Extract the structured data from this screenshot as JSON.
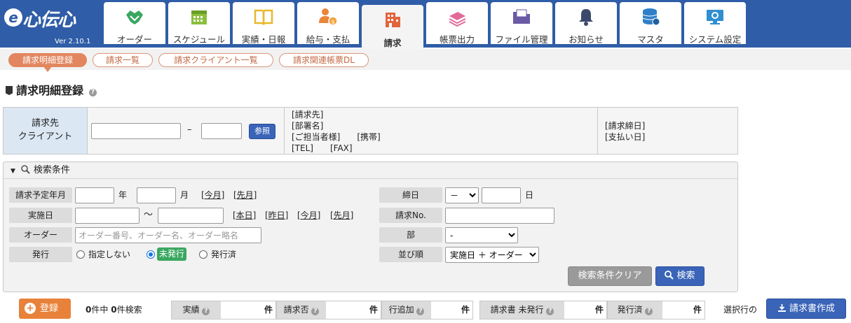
{
  "app": {
    "name": "心伝心",
    "mark": "e",
    "version": "Ver 2.10.1"
  },
  "nav": [
    {
      "label": "オーダー",
      "icon": "handshake-icon"
    },
    {
      "label": "スケジュール",
      "icon": "calendar-icon"
    },
    {
      "label": "実績・日報",
      "icon": "open-book-icon"
    },
    {
      "label": "給与・支払",
      "icon": "person-coin-icon"
    },
    {
      "label": "請求",
      "icon": "building-icon"
    },
    {
      "label": "帳票出力",
      "icon": "papers-icon"
    },
    {
      "label": "ファイル管理",
      "icon": "folder-icon"
    },
    {
      "label": "お知らせ",
      "icon": "bell-icon"
    },
    {
      "label": "マスタ",
      "icon": "database-icon"
    },
    {
      "label": "システム設定",
      "icon": "monitor-settings-icon"
    }
  ],
  "subtabs": [
    "請求明細登録",
    "請求一覧",
    "請求クライアント一覧",
    "請求関連帳票DL"
  ],
  "page": {
    "title": "請求明細登録"
  },
  "client": {
    "label_line1": "請求先",
    "label_line2": "クライアント",
    "dash": "–",
    "ref_button": "参照",
    "info_lines": [
      "[請求先]",
      "[部署名]",
      "[ご担当者様]　　[携帯]",
      "[TEL]　　[FAX]"
    ],
    "info2_lines": [
      "[請求締日]",
      "[支払い日]"
    ]
  },
  "search": {
    "header": "検索条件",
    "billing_month_label": "請求予定年月",
    "year": "年",
    "month": "月",
    "this_month": "[今月]",
    "last_month": "[先月]",
    "date_label": "実施日",
    "tilde": "～",
    "today": "[本日]",
    "yesterday": "[昨日]",
    "order_label": "オーダー",
    "order_placeholder": "オーダー番号、オーダー名、オーダー略名",
    "issue_label": "発行",
    "issue_opt1": "指定しない",
    "issue_opt2": "未発行",
    "issue_opt3": "発行済",
    "closing_label": "締日",
    "closing_value": "－",
    "day": "日",
    "invoice_no_label": "請求No.",
    "dept_label": "部",
    "dept_value": "-",
    "sort_label": "並び順",
    "sort_value": "実施日 ＋ オーダー",
    "clear_button": "検索条件クリア",
    "search_button": "検索"
  },
  "bottom": {
    "register_button": "登録",
    "count_total": "0",
    "count_mid": "件中",
    "count_found": "0",
    "count_suffix": "件検索",
    "stats": [
      {
        "label": "実績",
        "unit": "件"
      },
      {
        "label": "請求否",
        "unit": "件"
      },
      {
        "label": "行追加",
        "unit": "件"
      },
      {
        "label": "請求書 未発行",
        "unit": "件"
      },
      {
        "label": "発行済",
        "unit": "件"
      }
    ],
    "selected_rows": "選択行の",
    "create_invoice_button": "請求書作成"
  }
}
